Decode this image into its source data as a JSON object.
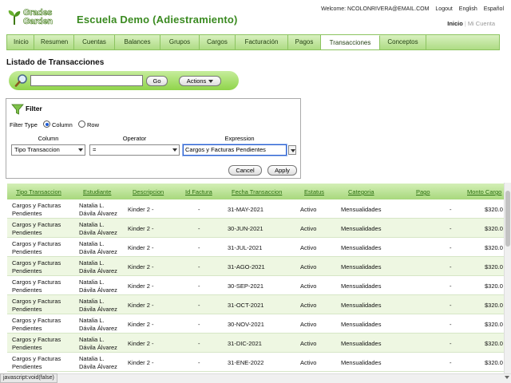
{
  "header": {
    "logo_line1": "Grades",
    "logo_line2": "Garden",
    "school_title": "Escuela Demo (Adiestramiento)",
    "welcome": "Welcome: NCOLONRIVERA@EMAIL.COM",
    "logout": "Logout",
    "english": "English",
    "spanish": "Español",
    "inicio": "Inicio",
    "mi_cuenta": "Mi Cuenta"
  },
  "nav": {
    "items": [
      "Inicio",
      "Resumen",
      "Cuentas",
      "Balances",
      "Grupos",
      "Cargos",
      "Facturación",
      "Pagos",
      "Transacciones",
      "Conceptos"
    ],
    "active": "Transacciones"
  },
  "page_title": "Listado de Transacciones",
  "search": {
    "value": "",
    "go_label": "Go",
    "actions_label": "Actions"
  },
  "filter": {
    "title": "Filter",
    "type_label": "Filter Type",
    "option_column": "Column",
    "option_row": "Row",
    "selected_type": "Column",
    "column_header": "Column",
    "operator_header": "Operator",
    "expression_header": "Expression",
    "column_value": "Tipo Transaccion",
    "operator_value": "=",
    "expression_value": "Cargos y Facturas Pendientes",
    "cancel_label": "Cancel",
    "apply_label": "Apply"
  },
  "table": {
    "headers": [
      "Tipo Transaccion",
      "Estudiante",
      "Descripcion",
      "Id Factura",
      "Fecha Transaccion",
      "Estatus",
      "Categoria",
      "Pago",
      "Monto Cargo"
    ],
    "rows": [
      {
        "tipo1": "Cargos y Facturas",
        "tipo2": "Pendientes",
        "est1": "Natalia L.",
        "est2": "Dávila Álvarez",
        "desc": "Kinder 2 -",
        "factura": "-",
        "fecha": "31-MAY-2021",
        "estatus": "Activo",
        "categoria": "Mensualidades",
        "pago": "-",
        "monto": "$320.0"
      },
      {
        "tipo1": "Cargos y Facturas",
        "tipo2": "Pendientes",
        "est1": "Natalia L.",
        "est2": "Dávila Álvarez",
        "desc": "Kinder 2 -",
        "factura": "-",
        "fecha": "30-JUN-2021",
        "estatus": "Activo",
        "categoria": "Mensualidades",
        "pago": "-",
        "monto": "$320.0"
      },
      {
        "tipo1": "Cargos y Facturas",
        "tipo2": "Pendientes",
        "est1": "Natalia L.",
        "est2": "Dávila Álvarez",
        "desc": "Kinder 2 -",
        "factura": "-",
        "fecha": "31-JUL-2021",
        "estatus": "Activo",
        "categoria": "Mensualidades",
        "pago": "-",
        "monto": "$320.0"
      },
      {
        "tipo1": "Cargos y Facturas",
        "tipo2": "Pendientes",
        "est1": "Natalia L.",
        "est2": "Dávila Álvarez",
        "desc": "Kinder 2 -",
        "factura": "-",
        "fecha": "31-AGO-2021",
        "estatus": "Activo",
        "categoria": "Mensualidades",
        "pago": "-",
        "monto": "$320.0"
      },
      {
        "tipo1": "Cargos y Facturas",
        "tipo2": "Pendientes",
        "est1": "Natalia L.",
        "est2": "Dávila Álvarez",
        "desc": "Kinder 2 -",
        "factura": "-",
        "fecha": "30-SEP-2021",
        "estatus": "Activo",
        "categoria": "Mensualidades",
        "pago": "-",
        "monto": "$320.0"
      },
      {
        "tipo1": "Cargos y Facturas",
        "tipo2": "Pendientes",
        "est1": "Natalia L.",
        "est2": "Dávila Álvarez",
        "desc": "Kinder 2 -",
        "factura": "-",
        "fecha": "31-OCT-2021",
        "estatus": "Activo",
        "categoria": "Mensualidades",
        "pago": "-",
        "monto": "$320.0"
      },
      {
        "tipo1": "Cargos y Facturas",
        "tipo2": "Pendientes",
        "est1": "Natalia L.",
        "est2": "Dávila Álvarez",
        "desc": "Kinder 2 -",
        "factura": "-",
        "fecha": "30-NOV-2021",
        "estatus": "Activo",
        "categoria": "Mensualidades",
        "pago": "-",
        "monto": "$320.0"
      },
      {
        "tipo1": "Cargos y Facturas",
        "tipo2": "Pendientes",
        "est1": "Natalia L.",
        "est2": "Dávila Álvarez",
        "desc": "Kinder 2 -",
        "factura": "-",
        "fecha": "31-DIC-2021",
        "estatus": "Activo",
        "categoria": "Mensualidades",
        "pago": "-",
        "monto": "$320.0"
      },
      {
        "tipo1": "Cargos y Facturas",
        "tipo2": "Pendientes",
        "est1": "Natalia L.",
        "est2": "Dávila Álvarez",
        "desc": "Kinder 2 -",
        "factura": "-",
        "fecha": "31-ENE-2022",
        "estatus": "Activo",
        "categoria": "Mensualidades",
        "pago": "-",
        "monto": "$320.0"
      }
    ]
  },
  "status_bar": "javascript:void(false)",
  "colors": {
    "brand_green": "#3a8a20",
    "nav_green": "#aedc84",
    "header_link": "#2b6e10",
    "row_alt": "#eef7e2"
  },
  "icons": {
    "search": "magnifier-icon",
    "filter": "funnel-icon"
  }
}
